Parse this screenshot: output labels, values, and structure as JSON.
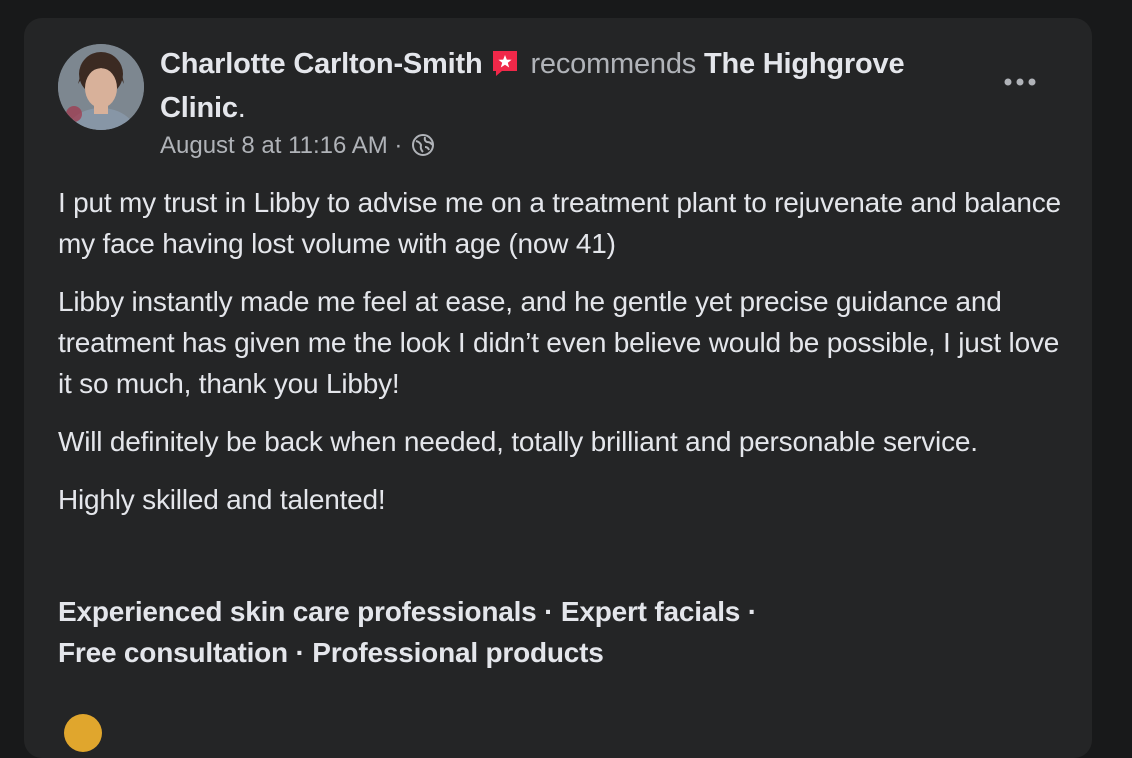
{
  "post": {
    "author": "Charlotte Carlton-Smith",
    "recommends_text": "recommends",
    "page_name": "The Highgrove Clinic",
    "period": ".",
    "timestamp": "August 8 at 11:16 AM",
    "separator": " · ",
    "audience_icon": "globe-icon",
    "recommend_icon": "recommendation-flag-icon",
    "more_icon": "more-options-icon",
    "paragraphs": [
      "I put my trust in Libby to advise me on a treatment plant to rejuvenate and balance my face having lost volume with age (now 41)",
      "Libby instantly made me feel at ease, and he gentle yet precise guidance and treatment has given me the look I didn’t even believe would be possible, I just love it so much, thank you Libby!",
      "Will definitely be back when needed, totally brilliant and personable service.",
      "Highly skilled and talented!"
    ],
    "tags": [
      "Experienced skin care professionals",
      "Expert facials",
      "Free consultation",
      "Professional products"
    ],
    "tag_separator": " · "
  },
  "colors": {
    "background": "#18191a",
    "card": "#242526",
    "primary_text": "#e4e6eb",
    "secondary_text": "#b0b3b8",
    "recommend_badge": "#f02849"
  }
}
